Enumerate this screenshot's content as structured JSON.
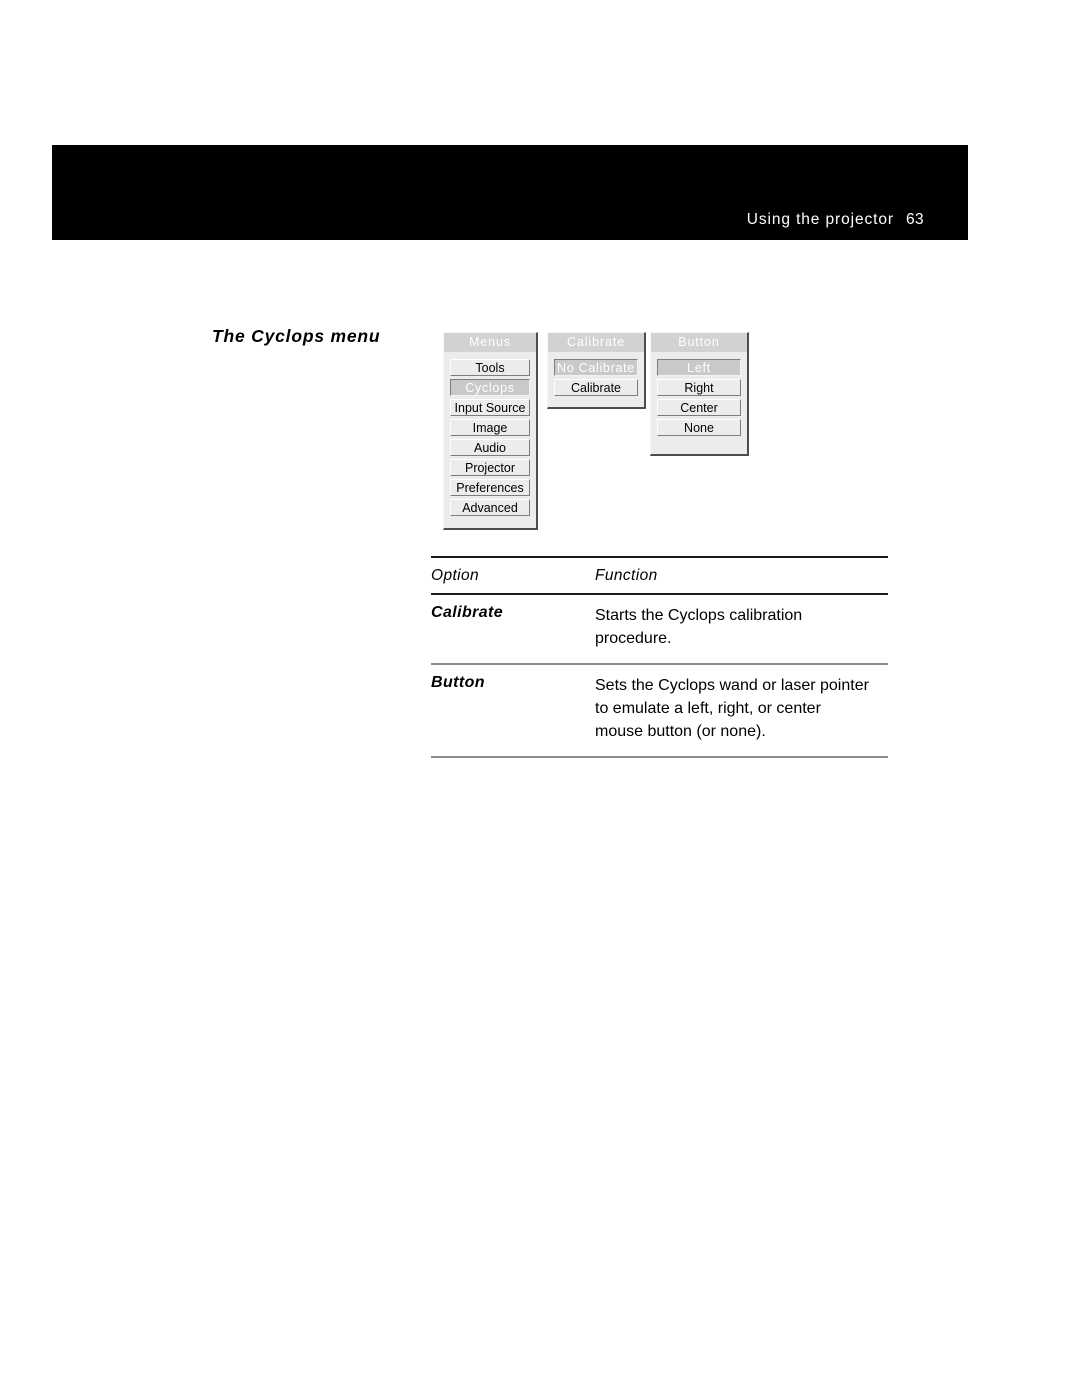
{
  "header": {
    "title": "Using the projector",
    "page_number": "63",
    "band_color": "#000000",
    "text_color": "#ffffff"
  },
  "section": {
    "heading": "The Cyclops menu"
  },
  "menu_figure": {
    "panels": [
      {
        "name": "menus",
        "title": "Menus",
        "items": [
          {
            "label": "Tools",
            "selected": false
          },
          {
            "label": "Cyclops",
            "selected": true
          },
          {
            "label": "Input Source",
            "selected": false
          },
          {
            "label": "Image",
            "selected": false
          },
          {
            "label": "Audio",
            "selected": false
          },
          {
            "label": "Projector",
            "selected": false
          },
          {
            "label": "Preferences",
            "selected": false
          },
          {
            "label": "Advanced",
            "selected": false
          }
        ]
      },
      {
        "name": "calibrate",
        "title": "Calibrate",
        "items": [
          {
            "label": "No Calibrate",
            "selected": true
          },
          {
            "label": "Calibrate",
            "selected": false
          }
        ]
      },
      {
        "name": "button",
        "title": "Button",
        "items": [
          {
            "label": "Left",
            "selected": true
          },
          {
            "label": "Right",
            "selected": false
          },
          {
            "label": "Center",
            "selected": false
          },
          {
            "label": "None",
            "selected": false
          }
        ]
      }
    ],
    "colors": {
      "panel_face": "#ececec",
      "title_bar": "#d2d2d2",
      "title_text": "#ffffff",
      "selected_face": "#c9c9c9",
      "selected_text": "#ffffff",
      "item_text": "#000000",
      "shadow": "#4d4d4d"
    }
  },
  "option_table": {
    "headers": {
      "option": "Option",
      "function": "Function"
    },
    "rows": [
      {
        "option": "Calibrate",
        "function_lines": [
          "Starts the Cyclops calibration",
          "procedure."
        ]
      },
      {
        "option": "Button",
        "function_lines": [
          "Sets the Cyclops wand or laser pointer",
          "to emulate a left, right, or center",
          "mouse button (or none)."
        ]
      }
    ]
  }
}
